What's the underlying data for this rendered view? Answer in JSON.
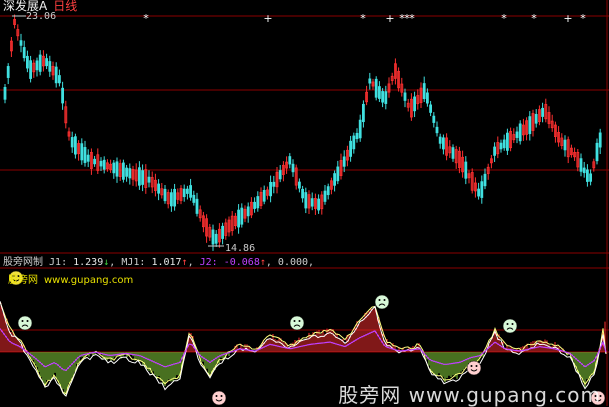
{
  "header": {
    "stock_name": "深发展A",
    "period": "日线"
  },
  "price_labels": {
    "high": "23.06",
    "low": "14.86"
  },
  "indicator": {
    "name": "股旁网制",
    "j1_label": "J1:",
    "j1_value": "1.239",
    "j1_arrow": "↓",
    "mj1_label": "MJ1:",
    "mj1_value": "1.017",
    "mj1_arrow": "↑",
    "j2_label": "J2:",
    "j2_value": "-0.068",
    "j2_arrow": "↑",
    "extra_value": "0.000,"
  },
  "site": {
    "name": "股旁网",
    "url": "www.gupang.com"
  },
  "watermark": "股旁网 www.gupang.com",
  "colors": {
    "background": "#000000",
    "up_candle": "#ff3030",
    "down_candle": "#40e0e0",
    "grid": "#8b0000",
    "ind_yellow": "#ffff80",
    "ind_purple": "#c040ff",
    "ind_white": "#ffffff"
  }
}
